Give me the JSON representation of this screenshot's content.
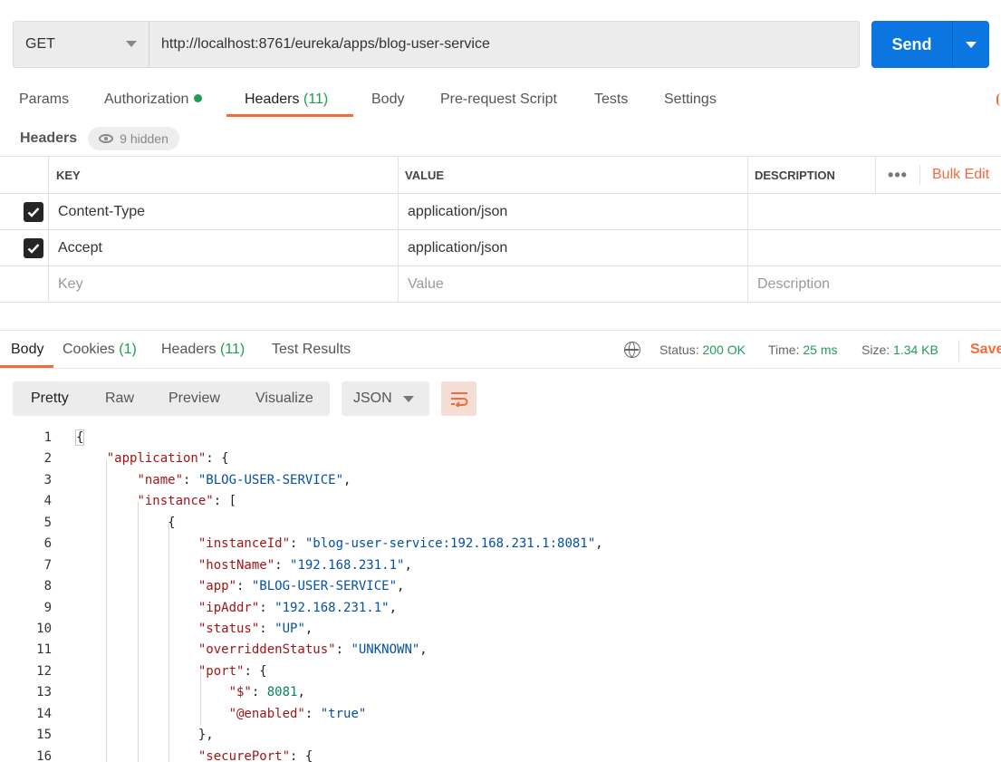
{
  "request": {
    "method": "GET",
    "url": "http://localhost:8761/eureka/apps/blog-user-service",
    "send_label": "Send"
  },
  "request_tabs": {
    "params": "Params",
    "authorization": "Authorization",
    "headers": "Headers",
    "headers_count": "(11)",
    "body": "Body",
    "prerequest": "Pre-request Script",
    "tests": "Tests",
    "settings": "Settings"
  },
  "headers_section": {
    "title": "Headers",
    "hidden_label": "9 hidden",
    "columns": {
      "key": "KEY",
      "value": "VALUE",
      "description": "DESCRIPTION"
    },
    "bulk_edit": "Bulk Edit",
    "more": "•••",
    "rows": [
      {
        "checked": true,
        "key": "Content-Type",
        "value": "application/json",
        "description": ""
      },
      {
        "checked": true,
        "key": "Accept",
        "value": "application/json",
        "description": ""
      }
    ],
    "placeholders": {
      "key": "Key",
      "value": "Value",
      "description": "Description"
    }
  },
  "response_tabs": {
    "body": "Body",
    "cookies": "Cookies",
    "cookies_count": "(1)",
    "headers": "Headers",
    "headers_count": "(11)",
    "test_results": "Test Results"
  },
  "response_meta": {
    "status_label": "Status:",
    "status_value": "200 OK",
    "time_label": "Time:",
    "time_value": "25 ms",
    "size_label": "Size:",
    "size_value": "1.34 KB",
    "save_label": "Save"
  },
  "format_toolbar": {
    "pretty": "Pretty",
    "raw": "Raw",
    "preview": "Preview",
    "visualize": "Visualize",
    "language": "JSON"
  },
  "colors": {
    "accent": "#f26b3a",
    "send": "#0b76e0",
    "success": "#1f9d55",
    "json_key": "#a31515",
    "json_string": "#0451a5",
    "json_number": "#098658"
  },
  "code_lines": [
    {
      "n": "1",
      "html": "<span class=\"brace-box\">{</span>"
    },
    {
      "n": "2",
      "html": "    <span class=\"k\">\"application\"</span>: {"
    },
    {
      "n": "3",
      "html": "        <span class=\"k\">\"name\"</span>: <span class=\"s\">\"BLOG-USER-SERVICE\"</span>,"
    },
    {
      "n": "4",
      "html": "        <span class=\"k\">\"instance\"</span>: ["
    },
    {
      "n": "5",
      "html": "            {"
    },
    {
      "n": "6",
      "html": "                <span class=\"k\">\"instanceId\"</span>: <span class=\"s\">\"blog-user-service:192.168.231.1:8081\"</span>,"
    },
    {
      "n": "7",
      "html": "                <span class=\"k\">\"hostName\"</span>: <span class=\"s\">\"192.168.231.1\"</span>,"
    },
    {
      "n": "8",
      "html": "                <span class=\"k\">\"app\"</span>: <span class=\"s\">\"BLOG-USER-SERVICE\"</span>,"
    },
    {
      "n": "9",
      "html": "                <span class=\"k\">\"ipAddr\"</span>: <span class=\"s\">\"192.168.231.1\"</span>,"
    },
    {
      "n": "10",
      "html": "                <span class=\"k\">\"status\"</span>: <span class=\"s\">\"UP\"</span>,"
    },
    {
      "n": "11",
      "html": "                <span class=\"k\">\"overriddenStatus\"</span>: <span class=\"s\">\"UNKNOWN\"</span>,"
    },
    {
      "n": "12",
      "html": "                <span class=\"k\">\"port\"</span>: {"
    },
    {
      "n": "13",
      "html": "                    <span class=\"k\">\"$\"</span>: <span class=\"n\">8081</span>,"
    },
    {
      "n": "14",
      "html": "                    <span class=\"k\">\"@enabled\"</span>: <span class=\"s\">\"true\"</span>"
    },
    {
      "n": "15",
      "html": "                },"
    },
    {
      "n": "16",
      "html": "                <span class=\"k\">\"securePort\"</span>: {"
    }
  ]
}
